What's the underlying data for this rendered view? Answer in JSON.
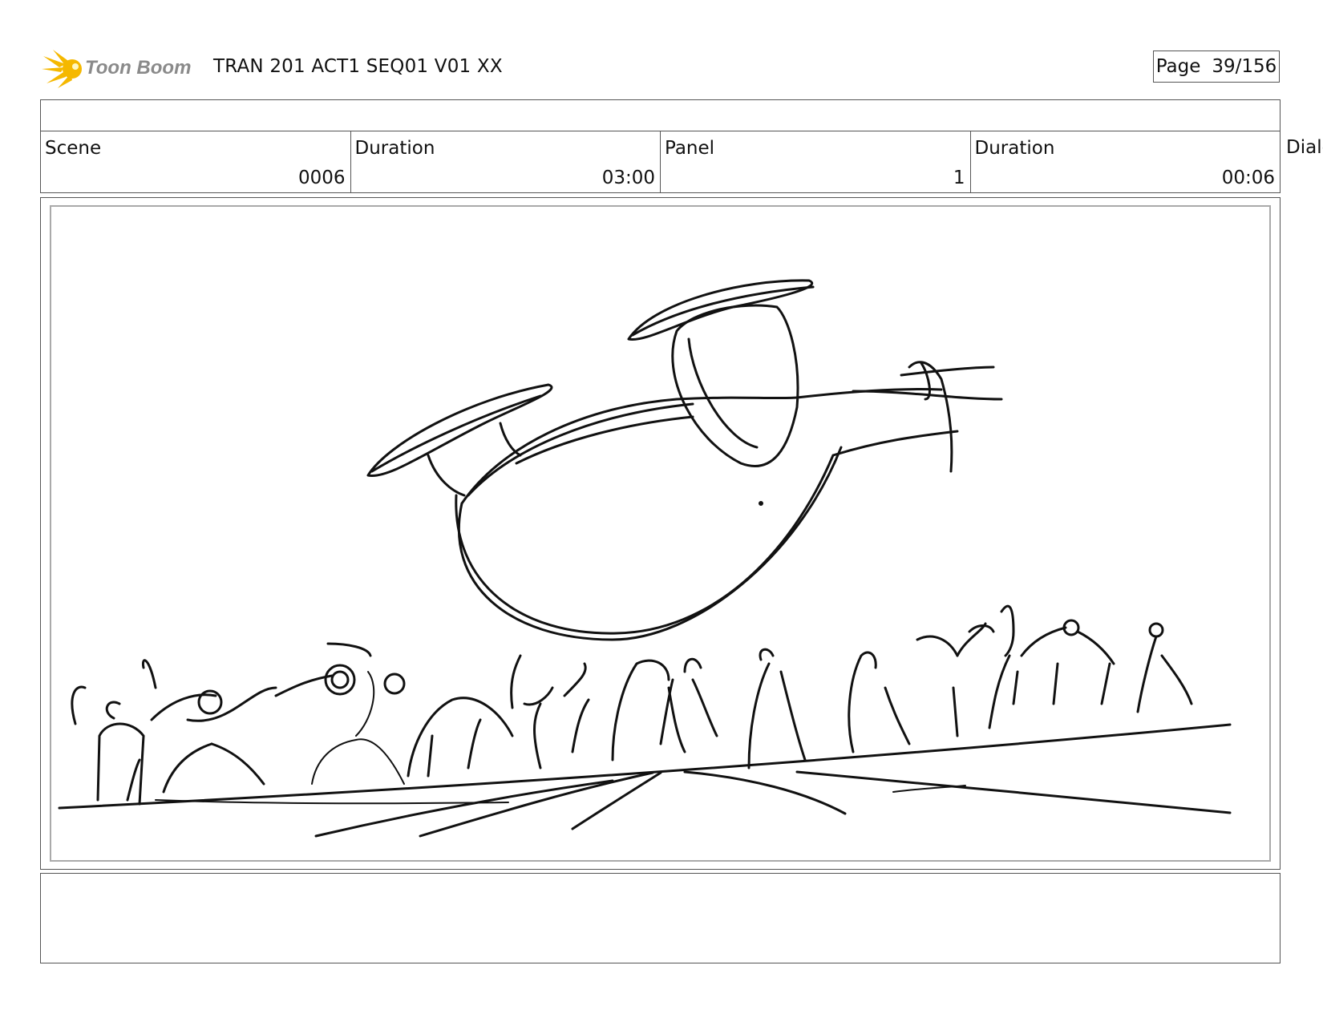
{
  "header": {
    "logo_text": "Toon Boom",
    "title": "TRAN 201 ACT1 SEQ01 V01 XX",
    "page_label": "Page",
    "page_value": "39/156"
  },
  "info": {
    "scene_label": "Scene",
    "scene_value": "0006",
    "scene_duration_label": "Duration",
    "scene_duration_value": "03:00",
    "panel_label": "Panel",
    "panel_value": "1",
    "panel_duration_label": "Duration",
    "panel_duration_value": "00:06",
    "overflow_label": "Dialo"
  },
  "colors": {
    "logo_star": "#f5b800",
    "logo_text": "#8a8a8a",
    "border": "#555555",
    "sketch": "#111111"
  },
  "icons": {
    "logo": "toon-boom-star-logo"
  }
}
